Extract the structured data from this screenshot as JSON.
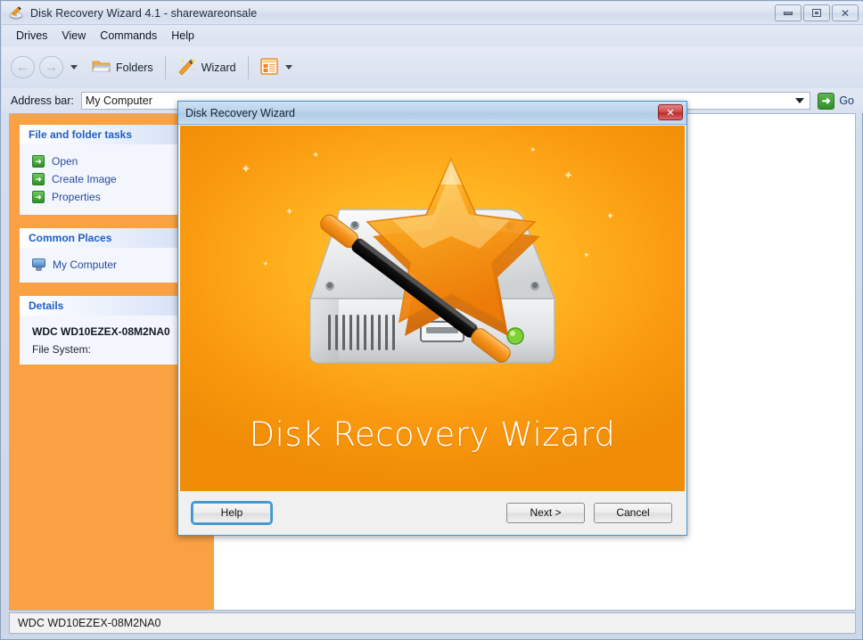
{
  "window": {
    "title": "Disk Recovery Wizard 4.1 - sharewareonsale",
    "app_icon": "disk-recovery-icon",
    "controls": {
      "minimize": "minimize-button",
      "maximize": "maximize-button",
      "close": "close-button",
      "close_glyph": "✕"
    }
  },
  "menu": {
    "items": [
      {
        "label": "Drives"
      },
      {
        "label": "View"
      },
      {
        "label": "Commands"
      },
      {
        "label": "Help"
      }
    ]
  },
  "toolbar": {
    "back_glyph": "←",
    "forward_glyph": "→",
    "folders_label": "Folders",
    "wizard_label": "Wizard",
    "views_icon": "views-list-icon"
  },
  "address": {
    "label": "Address bar:",
    "value": "My Computer",
    "placeholder": "My Computer",
    "go_label": "Go",
    "go_glyph": "➜"
  },
  "sidebar": {
    "panels": [
      {
        "title": "File and folder tasks",
        "tasks": [
          {
            "label": "Open",
            "icon": "green-arrow-icon"
          },
          {
            "label": "Create Image",
            "icon": "green-arrow-icon"
          },
          {
            "label": "Properties",
            "icon": "green-arrow-icon"
          }
        ]
      },
      {
        "title": "Common Places",
        "tasks": [
          {
            "label": "My Computer",
            "icon": "my-computer-icon"
          }
        ]
      }
    ],
    "details": {
      "title": "Details",
      "device": "WDC WD10EZEX-08M2NA0",
      "file_system_label": "File System:"
    }
  },
  "status_bar": {
    "text": "WDC WD10EZEX-08M2NA0"
  },
  "dialog": {
    "title": "Disk Recovery Wizard",
    "close_glyph": "✕",
    "splash_title": "Disk Recovery Wizard",
    "buttons": {
      "help": "Help",
      "next": "Next >",
      "cancel": "Cancel"
    }
  },
  "colors": {
    "brand_orange": "#f9a143",
    "splash_orange": "#ffb21f",
    "link_blue": "#274a9e",
    "panel_header_blue": "#1f5fc4",
    "green_icon": "#2e8d2a",
    "dialog_border_blue": "#3f96d2",
    "close_red": "#cf4e4e"
  }
}
